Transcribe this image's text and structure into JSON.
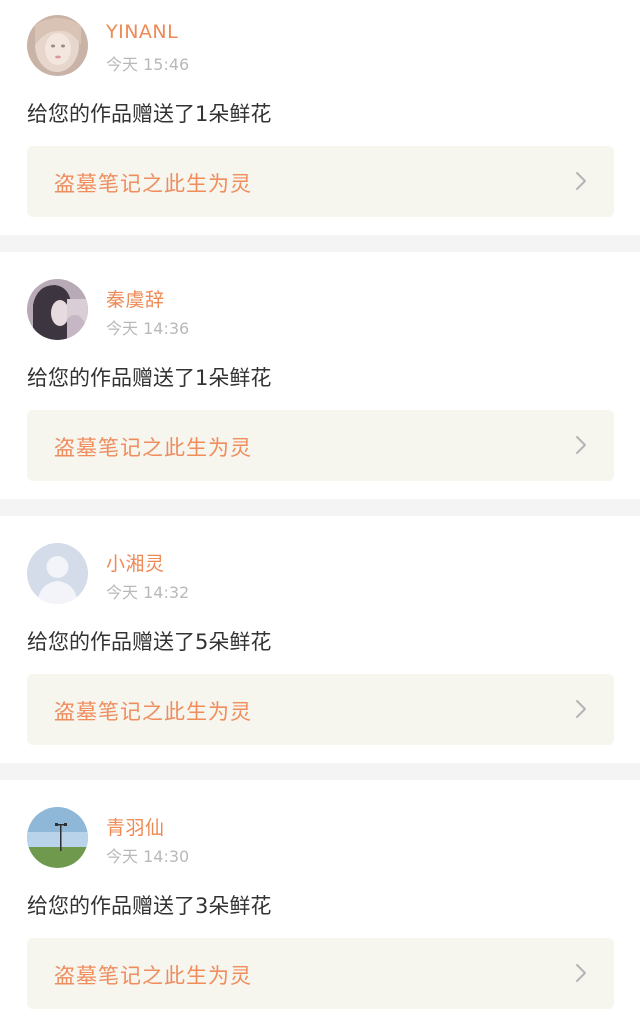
{
  "notifications": [
    {
      "username": "YINANL",
      "time": "今天 15:46",
      "message": "给您的作品赠送了1朵鲜花",
      "work_title": "盗墓笔记之此生为灵",
      "avatar_icon": "avatar-girl-portrait"
    },
    {
      "username": "秦虞辞",
      "time": "今天 14:36",
      "message": "给您的作品赠送了1朵鲜花",
      "work_title": "盗墓笔记之此生为灵",
      "avatar_icon": "avatar-girl-dark-hair"
    },
    {
      "username": "小湘灵",
      "time": "今天 14:32",
      "message": "给您的作品赠送了5朵鲜花",
      "work_title": "盗墓笔记之此生为灵",
      "avatar_icon": "avatar-default-silhouette"
    },
    {
      "username": "青羽仙",
      "time": "今天 14:30",
      "message": "给您的作品赠送了3朵鲜花",
      "work_title": "盗墓笔记之此生为灵",
      "avatar_icon": "avatar-landscape-lamp"
    }
  ],
  "colors": {
    "username": "#ee8a55",
    "time": "#b9b9b9",
    "message": "#333333",
    "work_title": "#ef8d5d",
    "work_link_bg": "#f6f5ee",
    "separator": "#f5f4f4"
  },
  "icons": {
    "chevron": "chevron-right-icon"
  }
}
